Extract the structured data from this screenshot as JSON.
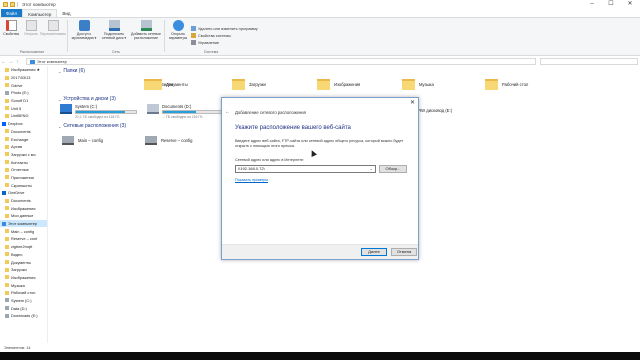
{
  "window": {
    "title": "Этот компьютер",
    "controls": [
      "–",
      "☐",
      "✕"
    ]
  },
  "tabs": [
    "Файл",
    "Компьютер",
    "Вид"
  ],
  "ribbon": {
    "location_group": {
      "label": "Расположение",
      "buttons": [
        "Свойства",
        "Открыть",
        "Переименовать"
      ]
    },
    "network_group": {
      "label": "Сеть",
      "buttons": [
        "Доступ к мультимедиа ▾",
        "Подключить сетевой диск ▾",
        "Добавить сетевое расположение"
      ]
    },
    "system_group": {
      "label": "Система",
      "open_settings": "Открыть параметры",
      "small_buttons": [
        "Удалить или изменить программу",
        "Свойства системы",
        "Управление"
      ]
    }
  },
  "address": {
    "path": "Этот компьютер",
    "search_placeholder": ""
  },
  "left_nav": [
    "Изображения ★",
    "2017\\03\\13",
    "Gdrive",
    "Photo (E:)",
    "Sonoff D1",
    "Unit 5",
    "Unit5ENG",
    "Dropbox",
    "Documents",
    "Exchange",
    "Арxив",
    "Загрузки с мо",
    "Контакты",
    "Отчетные",
    "Приложения",
    "Скриншоты",
    "OneDrive",
    "Documents",
    "Изображения",
    "Мои данные",
    "Этот компьютер",
    "Main – config",
    "Reserve – conf",
    "zigbee2mqtt",
    "Видео",
    "Документы",
    "Загрузки",
    "Изображения",
    "Музыка",
    "Рабочий стол",
    "System (C:)",
    "Data (D:)",
    "Downloads (E:)"
  ],
  "content": {
    "folders_section": "Папки (6)",
    "folders": [
      "Видео",
      "Документы",
      "Загрузки",
      "Изображения",
      "Музыка",
      "Рабочий стол"
    ],
    "devices_section": "Устройства и диски (3)",
    "drives": [
      {
        "name": "System (C:)",
        "free": "21,1 ГБ свободно из 118 ГБ",
        "fill": 0.82
      },
      {
        "name": "Documents (D:)",
        "free": "... ГБ свободно из 116 ГБ",
        "fill": 0.55
      },
      {
        "name": "BD-RW дисковод (E:)"
      }
    ],
    "network_section": "Сетевые расположения (3)",
    "network": [
      "Main – config",
      "Reserve – config"
    ]
  },
  "status": {
    "items": "Элементов: 14"
  },
  "dialog": {
    "title": "Добавление сетевого расположения",
    "heading": "Укажите расположение вашего веб-сайта",
    "description": "Введите адрес веб-сайта, FTP-сайта или сетевой адрес общего ресурса, который можно будет открыть с помощью этого ярлыка.",
    "field_label": "Сетевой адрес или адрес в Интернете:",
    "field_value": "\\\\192.168.0.72\\",
    "browse": "Обзор...",
    "examples_link": "Показать примеры",
    "next": "Далее",
    "cancel": "Отмена"
  },
  "colors": {
    "accent": "#1979ca",
    "header_blue": "#1e3287",
    "selection": "#cce8ff",
    "folder": "#f8d775",
    "drive_bar": "#26a0da"
  }
}
